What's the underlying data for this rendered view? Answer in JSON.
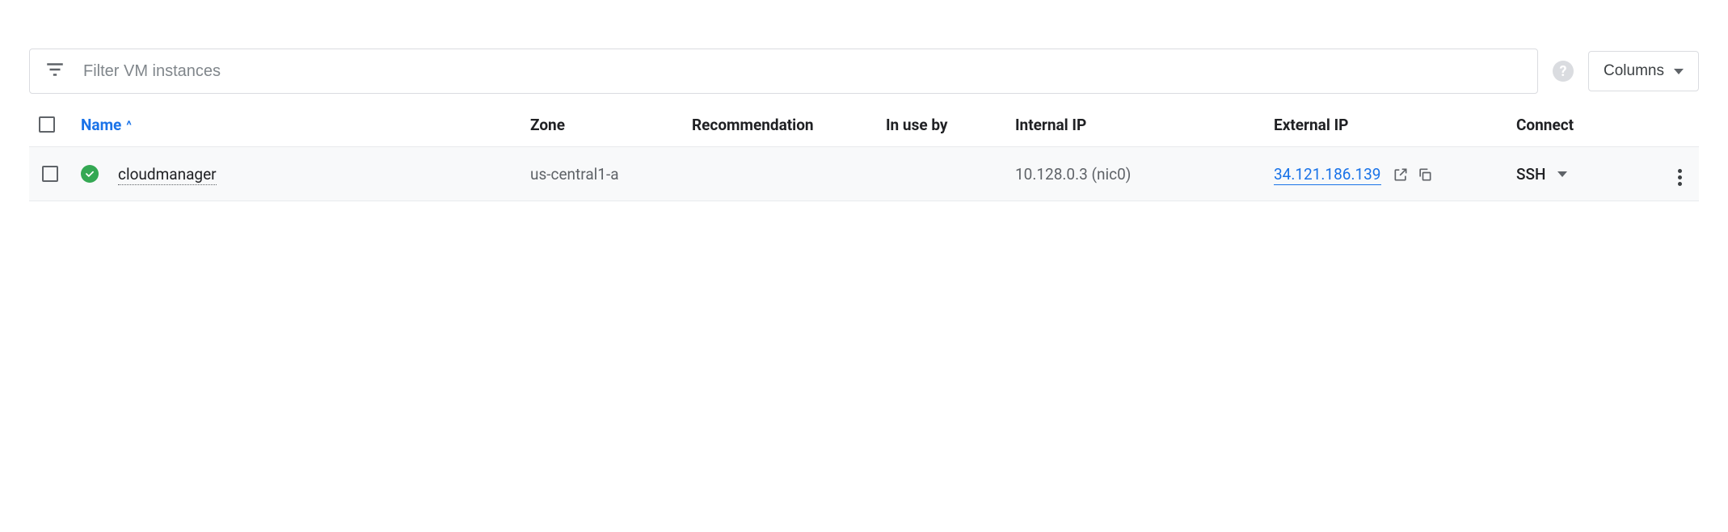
{
  "filter": {
    "placeholder": "Filter VM instances"
  },
  "columns_button": {
    "label": "Columns"
  },
  "table": {
    "headers": {
      "name": "Name",
      "zone": "Zone",
      "recommendation": "Recommendation",
      "in_use_by": "In use by",
      "internal_ip": "Internal IP",
      "external_ip": "External IP",
      "connect": "Connect"
    },
    "sort": {
      "column": "name",
      "direction": "asc",
      "glyph": "^"
    },
    "rows": [
      {
        "status": "running",
        "name": "cloudmanager",
        "zone": "us-central1-a",
        "recommendation": "",
        "in_use_by": "",
        "internal_ip": {
          "address": "10.128.0.3",
          "interface": "nic0"
        },
        "external_ip": "34.121.186.139",
        "connect": {
          "label": "SSH"
        }
      }
    ]
  }
}
